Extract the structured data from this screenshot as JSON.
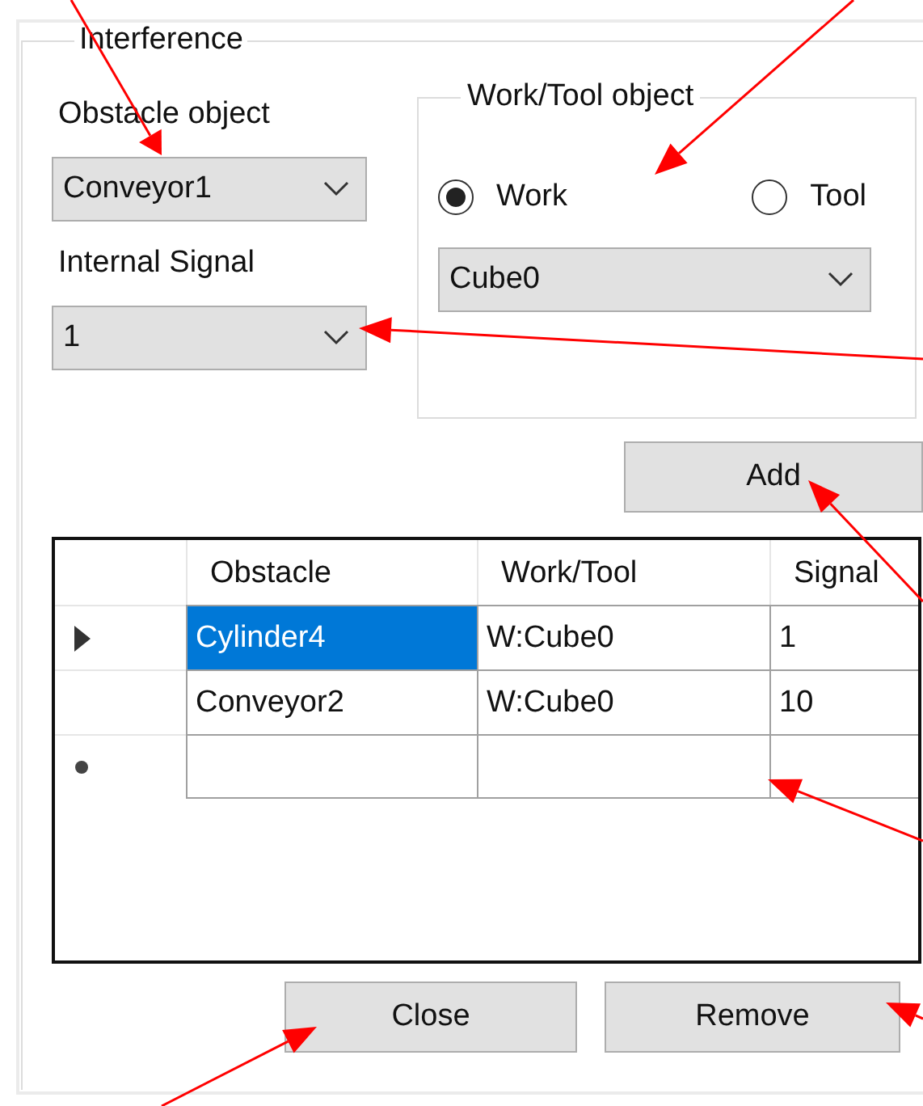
{
  "group": {
    "title": "Interference",
    "obstacle": {
      "label": "Obstacle object",
      "value": "Conveyor1"
    },
    "signal": {
      "label": "Internal Signal",
      "value": "1"
    },
    "work_tool": {
      "title": "Work/Tool object",
      "options": [
        {
          "label": "Work",
          "selected": true
        },
        {
          "label": "Tool",
          "selected": false
        }
      ],
      "value": "Cube0"
    },
    "add_button": "Add",
    "table": {
      "columns": [
        "Obstacle",
        "Work/Tool",
        "Signal"
      ],
      "rows": [
        {
          "current": true,
          "cells": [
            {
              "text": "Cylinder4",
              "selected": true
            },
            {
              "text": "W:Cube0",
              "selected": false
            },
            {
              "text": "1",
              "selected": false
            }
          ]
        },
        {
          "current": false,
          "cells": [
            {
              "text": "Conveyor2",
              "selected": false
            },
            {
              "text": "W:Cube0",
              "selected": false
            },
            {
              "text": "10",
              "selected": false
            }
          ]
        }
      ]
    },
    "buttons": [
      "Close",
      "Remove"
    ]
  }
}
